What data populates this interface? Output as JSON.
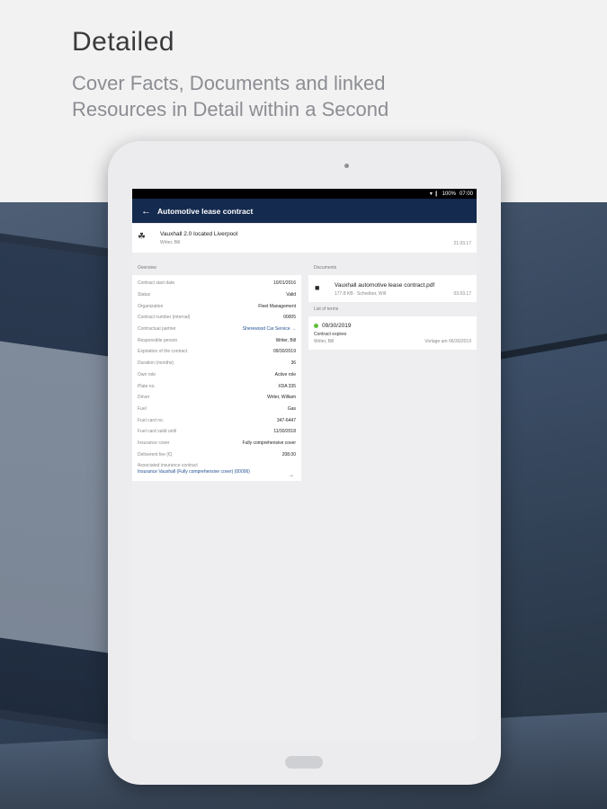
{
  "promo": {
    "headline": "Detailed",
    "subline": "Cover Facts, Documents and linked Resources in Detail within a Second"
  },
  "status_bar": {
    "signal": "▾ ❙",
    "battery": "100%",
    "time": "07:00"
  },
  "app_bar": {
    "back_icon": "←",
    "title": "Automotive lease contract"
  },
  "header": {
    "icon": "☘",
    "name": "Vauxhall 2.0 located Liverpool",
    "sub": "Writer, Bill",
    "date": "21.03.17"
  },
  "overview": {
    "label": "Overview",
    "rows": [
      {
        "k": "Contract start date",
        "v": "10/01/2016"
      },
      {
        "k": "Status",
        "v": "Valid"
      },
      {
        "k": "Organization",
        "v": "Fleet Management"
      },
      {
        "k": "Contract number (internal)",
        "v": "00005"
      },
      {
        "k": "Contractual partner",
        "v": "Sherewood Car Service →"
      },
      {
        "k": "Responsible person",
        "v": "Writer, Bill"
      },
      {
        "k": "Expiration of the contract",
        "v": "09/30/2019"
      },
      {
        "k": "Duration (months)",
        "v": "36"
      },
      {
        "k": "Own role",
        "v": "Active role"
      },
      {
        "k": "Plate no.",
        "v": "XDA 335"
      },
      {
        "k": "Driver",
        "v": "Writer, William"
      },
      {
        "k": "Fuel",
        "v": "Gas"
      },
      {
        "k": "Fuel card no.",
        "v": "347-6447"
      },
      {
        "k": "Fuel card valid until",
        "v": "11/30/2018"
      },
      {
        "k": "Insurance cover",
        "v": "Fully comprehensive cover"
      },
      {
        "k": "Deliverent fee (€)",
        "v": "208.00"
      }
    ],
    "assoc_label": "Associated insurance contract",
    "assoc_value": "Insurance Vauxhall (Fully comprehensive cover) (00006)",
    "assoc_arrow": "→"
  },
  "documents": {
    "label": "Documents",
    "icon": "■",
    "file_name": "Vauxhall automotive lease contract.pdf",
    "meta": "177.8 KB · Schreiber, Will",
    "date": "03.03.17"
  },
  "terms": {
    "label": "List of terms",
    "date": "09/30/2019",
    "desc": "Contract expires",
    "user": "Writer, Bill",
    "meta": "Vorlage am 06/30/2019"
  },
  "colors": {
    "app_bar": "#142a4e",
    "term_dot": "#5fbf3a",
    "link": "#1f4e8f"
  }
}
